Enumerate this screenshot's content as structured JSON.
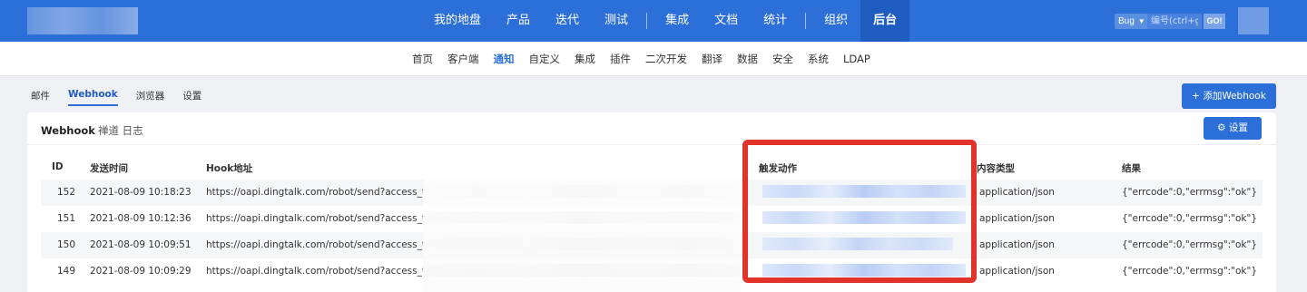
{
  "topnav": {
    "items": [
      "我的地盘",
      "产品",
      "迭代",
      "测试",
      "集成",
      "文档",
      "统计",
      "组织",
      "后台"
    ],
    "active": "后台",
    "bug_select": "Bug",
    "search_placeholder": "编号(ctrl+g)",
    "go_label": "GO!"
  },
  "subnav": {
    "items": [
      "首页",
      "客户端",
      "通知",
      "自定义",
      "集成",
      "插件",
      "二次开发",
      "翻译",
      "数据",
      "安全",
      "系统",
      "LDAP"
    ],
    "active": "通知"
  },
  "tabs": {
    "items": [
      "邮件",
      "Webhook",
      "浏览器",
      "设置"
    ],
    "active": "Webhook"
  },
  "add_button": "添加Webhook",
  "panel": {
    "title_bold": "Webhook",
    "title_rest": "禅道 日志",
    "settings_button": "设置"
  },
  "table": {
    "headers": {
      "id": "ID",
      "time": "发送时间",
      "url": "Hook地址",
      "action": "触发动作",
      "content_type": "内容类型",
      "result": "结果"
    },
    "rows": [
      {
        "id": "152",
        "time": "2021-08-09 10:18:23",
        "url": "https://oapi.dingtalk.com/robot/send?access_toker",
        "content_type": "application/json",
        "result": "{\"errcode\":0,\"errmsg\":\"ok\"}"
      },
      {
        "id": "151",
        "time": "2021-08-09 10:12:36",
        "url": "https://oapi.dingtalk.com/robot/send?access_toker",
        "content_type": "application/json",
        "result": "{\"errcode\":0,\"errmsg\":\"ok\"}"
      },
      {
        "id": "150",
        "time": "2021-08-09 10:09:51",
        "url": "https://oapi.dingtalk.com/robot/send?access_toker",
        "content_type": "application/json",
        "result": "{\"errcode\":0,\"errmsg\":\"ok\"}"
      },
      {
        "id": "149",
        "time": "2021-08-09 10:09:29",
        "url": "https://oapi.dingtalk.com/robot/send?access_toker",
        "content_type": "application/json",
        "result": "{\"errcode\":0,\"errmsg\":\"ok\"}"
      }
    ]
  },
  "colors": {
    "brand": "#2d6fd8",
    "highlight_box": "#e2332a"
  }
}
